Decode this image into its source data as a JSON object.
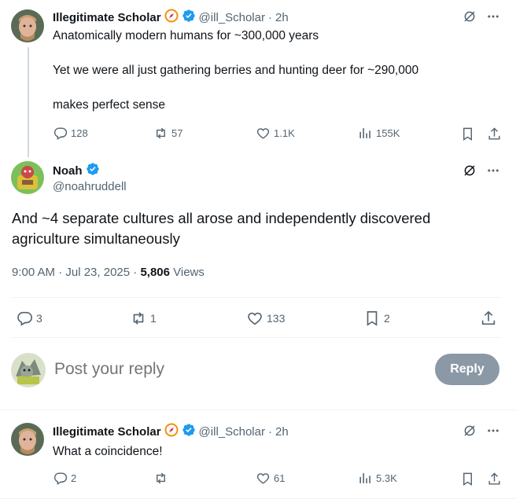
{
  "colors": {
    "accent": "#1d9bf0",
    "muted": "#536471",
    "text": "#0f1419",
    "reply_button_bg": "#8b98a5"
  },
  "parent_tweet": {
    "author_name": "Illegitimate Scholar",
    "handle": "@ill_Scholar",
    "time": "2h",
    "lines": [
      "Anatomically modern humans for ~300,000 years",
      "Yet we were all just gathering berries and hunting deer for ~290,000",
      "makes perfect sense"
    ],
    "stats": {
      "replies": "128",
      "reposts": "57",
      "likes": "1.1K",
      "views": "155K"
    }
  },
  "main_tweet": {
    "author_name": "Noah",
    "handle": "@noahruddell",
    "text": "And ~4 separate cultures all arose and independently discovered agriculture simultaneously",
    "timestamp": "9:00 AM · Jul 23, 2025 · ",
    "view_count": "5,806",
    "views_label": " Views",
    "stats": {
      "replies": "3",
      "reposts": "1",
      "likes": "133",
      "bookmarks": "2"
    }
  },
  "reply_box": {
    "placeholder": "Post your reply",
    "button_label": "Reply"
  },
  "reply_tweet": {
    "author_name": "Illegitimate Scholar",
    "handle": "@ill_Scholar",
    "time": "2h",
    "text": "What a coincidence!",
    "stats": {
      "replies": "2",
      "reposts": "",
      "likes": "61",
      "views": "5.3K"
    }
  }
}
